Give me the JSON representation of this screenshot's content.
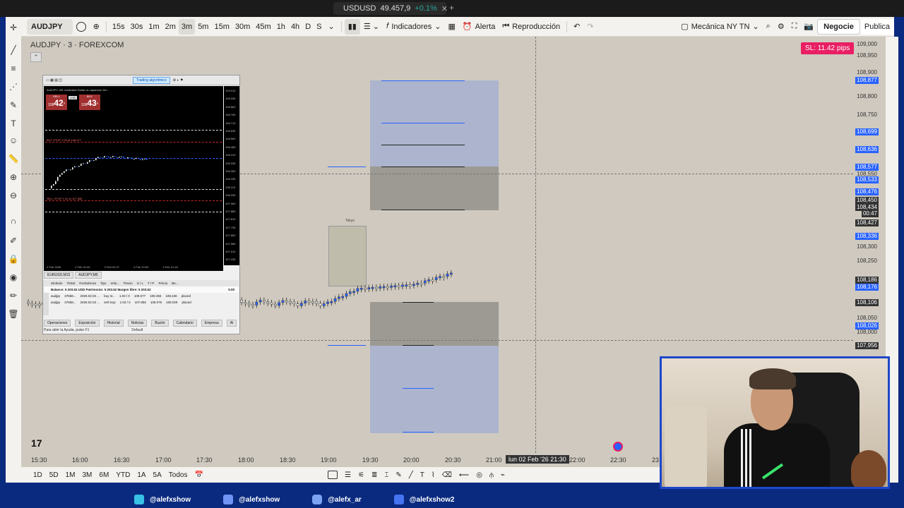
{
  "browser": {
    "tab_title": "USDUSD",
    "tab_price": "49.457,9",
    "tab_change": "+0.1%"
  },
  "toolbar": {
    "symbol": "AUDJPY",
    "intervals": [
      "15s",
      "30s",
      "1m",
      "2m",
      "3m",
      "5m",
      "15m",
      "30m",
      "45m",
      "1h",
      "4h",
      "D",
      "S"
    ],
    "active_interval": "3m",
    "indicators_label": "Indicadores",
    "alert_label": "Alerta",
    "replay_label": "Reproducción",
    "layout_name": "Mecánica NY TN",
    "trade_label": "Negocie",
    "publish_label": "Publica"
  },
  "chart": {
    "title": "AUDJPY · 3 · FOREXCOM",
    "sl_badge": "SL: 11.42 pips",
    "tokyo_label": "Tokyo",
    "price_labels": [
      {
        "text": "109,000",
        "style": "plain"
      },
      {
        "text": "108,950",
        "style": "plain"
      },
      {
        "text": "108,900",
        "style": "plain"
      },
      {
        "text": "108,877",
        "style": "blue"
      },
      {
        "text": "108,800",
        "style": "plain"
      },
      {
        "text": "108,750",
        "style": "plain"
      },
      {
        "text": "108,699",
        "style": "blue"
      },
      {
        "text": "108,636",
        "style": "blue"
      },
      {
        "text": "108,577",
        "style": "blue"
      },
      {
        "text": "108,550",
        "style": "plain"
      },
      {
        "text": "108,533",
        "style": "blue"
      },
      {
        "text": "108,476",
        "style": "blue"
      },
      {
        "text": "108,450",
        "style": "dark"
      },
      {
        "text": "108,434",
        "style": "dark"
      },
      {
        "text": "00:47",
        "style": "dark"
      },
      {
        "text": "108,427",
        "style": "dark"
      },
      {
        "text": "108,336",
        "style": "blue"
      },
      {
        "text": "108,300",
        "style": "plain"
      },
      {
        "text": "108,250",
        "style": "plain"
      },
      {
        "text": "108,186",
        "style": "dark"
      },
      {
        "text": "108,176",
        "style": "blue"
      },
      {
        "text": "108,106",
        "style": "dark"
      },
      {
        "text": "108,050",
        "style": "plain"
      },
      {
        "text": "108,026",
        "style": "blue"
      },
      {
        "text": "108,000",
        "style": "plain"
      },
      {
        "text": "107,956",
        "style": "dark"
      }
    ],
    "time_labels": [
      "15:30",
      "16:00",
      "16:30",
      "17:00",
      "17:30",
      "18:00",
      "18:30",
      "19:00",
      "19:30",
      "20:00",
      "20:30",
      "21:00",
      "22:00",
      "22:30",
      "23"
    ],
    "crosshair_time": "lun 02 Feb '26  21:30"
  },
  "bottombar": {
    "ranges": [
      "1D",
      "5D",
      "1M",
      "3M",
      "6M",
      "YTD",
      "1A",
      "5A",
      "Todos"
    ]
  },
  "mt5": {
    "algo_label": "Trading algorítmico",
    "chart_title": "AUDJPY, M5: Australian Dollar vs Japanese Yen",
    "sell_label": "SELL",
    "buy_label": "BUY",
    "lot": "1.00",
    "bid_small": "108",
    "bid_big": "42",
    "bid_sup": "9",
    "ask_small": "108",
    "ask_big": "43",
    "ask_sup": "6",
    "buy_stop_label": "BUY STOP 1.03 at 108.577",
    "sell_stop_label": "SELL STOP 1.03 at 107.856",
    "price_labels": [
      "109.010",
      "108.935",
      "108.860",
      "108.785",
      "108.710",
      "108.635",
      "108.560",
      "108.485",
      "108.410",
      "108.335",
      "108.260",
      "108.185",
      "108.110",
      "108.035",
      "107.960",
      "107.885",
      "107.810",
      "107.735",
      "107.660",
      "107.585",
      "107.510",
      "107.435"
    ],
    "times": [
      "2 Feb 2026",
      "2 Feb 01:00",
      "2 Feb 02:37",
      "2 Feb 10:53",
      "2 Feb 12:18"
    ],
    "chart_tabs": [
      "EURUSD,M15",
      "AUDJPY,M5"
    ],
    "table_headers": [
      "Símbolo",
      "Ticket",
      "Fecha/Hora",
      "Tipo",
      "Volu...",
      "Precio",
      "S / L",
      "T / P",
      "Precio",
      "Be..."
    ],
    "balance_row": "Balance: 5 203.52 USD  Patrimonio: 5 203.52  Margen libre: 5 203.52",
    "balance_value": "0.00",
    "rows": [
      [
        "audjpy",
        "37658...",
        "2026.02.03 ...",
        "buy st...",
        "1.03 / 0",
        "108.577",
        "108.456",
        "108.436",
        "placed"
      ],
      [
        "audjpy",
        "37658...",
        "2026.02.03 ...",
        "sell stop",
        "1.03 / 0",
        "107.856",
        "108.076",
        "108.029",
        "placed"
      ]
    ],
    "bottom_tabs": [
      "Operaciones",
      "Exposición",
      "Historial",
      "Noticias",
      "Buzón",
      "Calendario",
      "Empresa",
      "Al"
    ],
    "status_left": "Para abrir la Ayuda, pulse F1",
    "status_right": "Default"
  },
  "social": {
    "items": [
      "@alefxshow",
      "@alefxshow",
      "@alefx_ar",
      "@alefxshow2"
    ]
  }
}
